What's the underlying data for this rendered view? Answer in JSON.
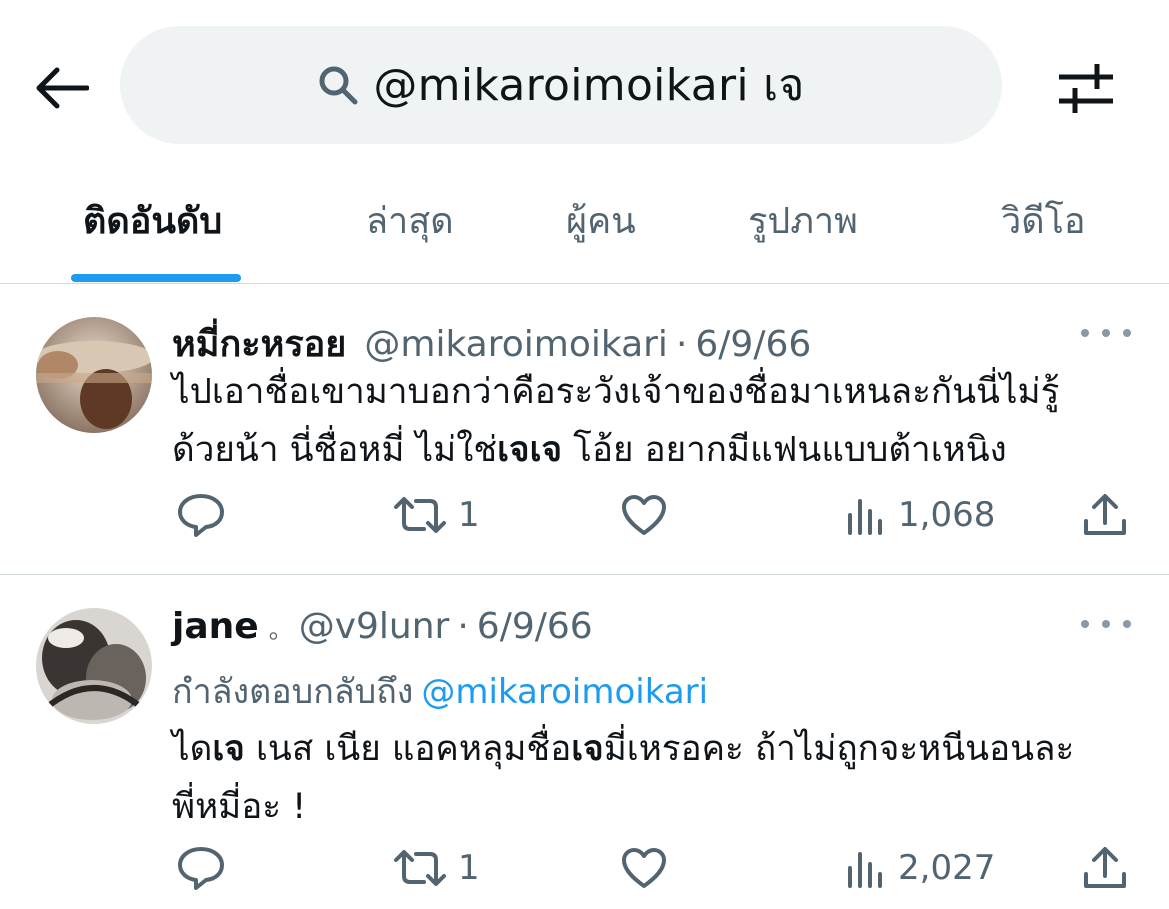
{
  "search": {
    "query": "@mikaroimoikari เจ"
  },
  "tabs": [
    {
      "label": "ติดอันดับ",
      "active": true
    },
    {
      "label": "ล่าสุด",
      "active": false
    },
    {
      "label": "ผู้คน",
      "active": false
    },
    {
      "label": "รูปภาพ",
      "active": false
    },
    {
      "label": "วิดีโอ",
      "active": false
    }
  ],
  "posts": [
    {
      "display_name": "หมี่กะหรอย",
      "handle": "@mikaroimoikari",
      "separator": "·",
      "date": "6/9/66",
      "text_line1": "ไปเอาชื่อเขามาบอกว่าคือระวังเจ้าของชื่อมาเหนละกันนี่ไม่รู้",
      "text_line2_a": "ด้วยน้า นี่ชื่อหมี่ ไม่ใช่",
      "text_line2_b": "เจเจ",
      "text_line2_c": " โอ้ย อยากมีแฟนแบบต้าเหนิง",
      "replies": "",
      "reposts": "1",
      "likes": "",
      "views": "1,068"
    },
    {
      "display_name": "jane",
      "name_suffix": "。",
      "handle": "@v9lunr",
      "separator": "·",
      "date": "6/9/66",
      "reply_label": "กำลังตอบกลับถึง",
      "reply_mention": "@mikaroimoikari",
      "text_line1_a": "ได",
      "text_line1_b": "เจ",
      "text_line1_c": " เนส เนีย แอคหลุมชื่อ",
      "text_line1_d": "เจ",
      "text_line1_e": "มี่เหรอคะ  ถ้าไม่ถูกจะหนีนอนละ",
      "text_line2": "พี่หมี่อะ !",
      "replies": "",
      "reposts": "1",
      "likes": "",
      "views": "2,027"
    }
  ],
  "colors": {
    "accent": "#1d9bf0",
    "muted": "#536471",
    "text": "#0f1419",
    "search_bg": "#eff3f4",
    "divider": "#cfd9de"
  },
  "icons": {
    "back": "arrow-left-icon",
    "search": "search-icon",
    "filter": "sliders-icon",
    "reply": "speech-bubble-icon",
    "repost": "repost-icon",
    "like": "heart-icon",
    "views": "bar-chart-icon",
    "share": "share-icon",
    "more": "more-dots-icon"
  }
}
